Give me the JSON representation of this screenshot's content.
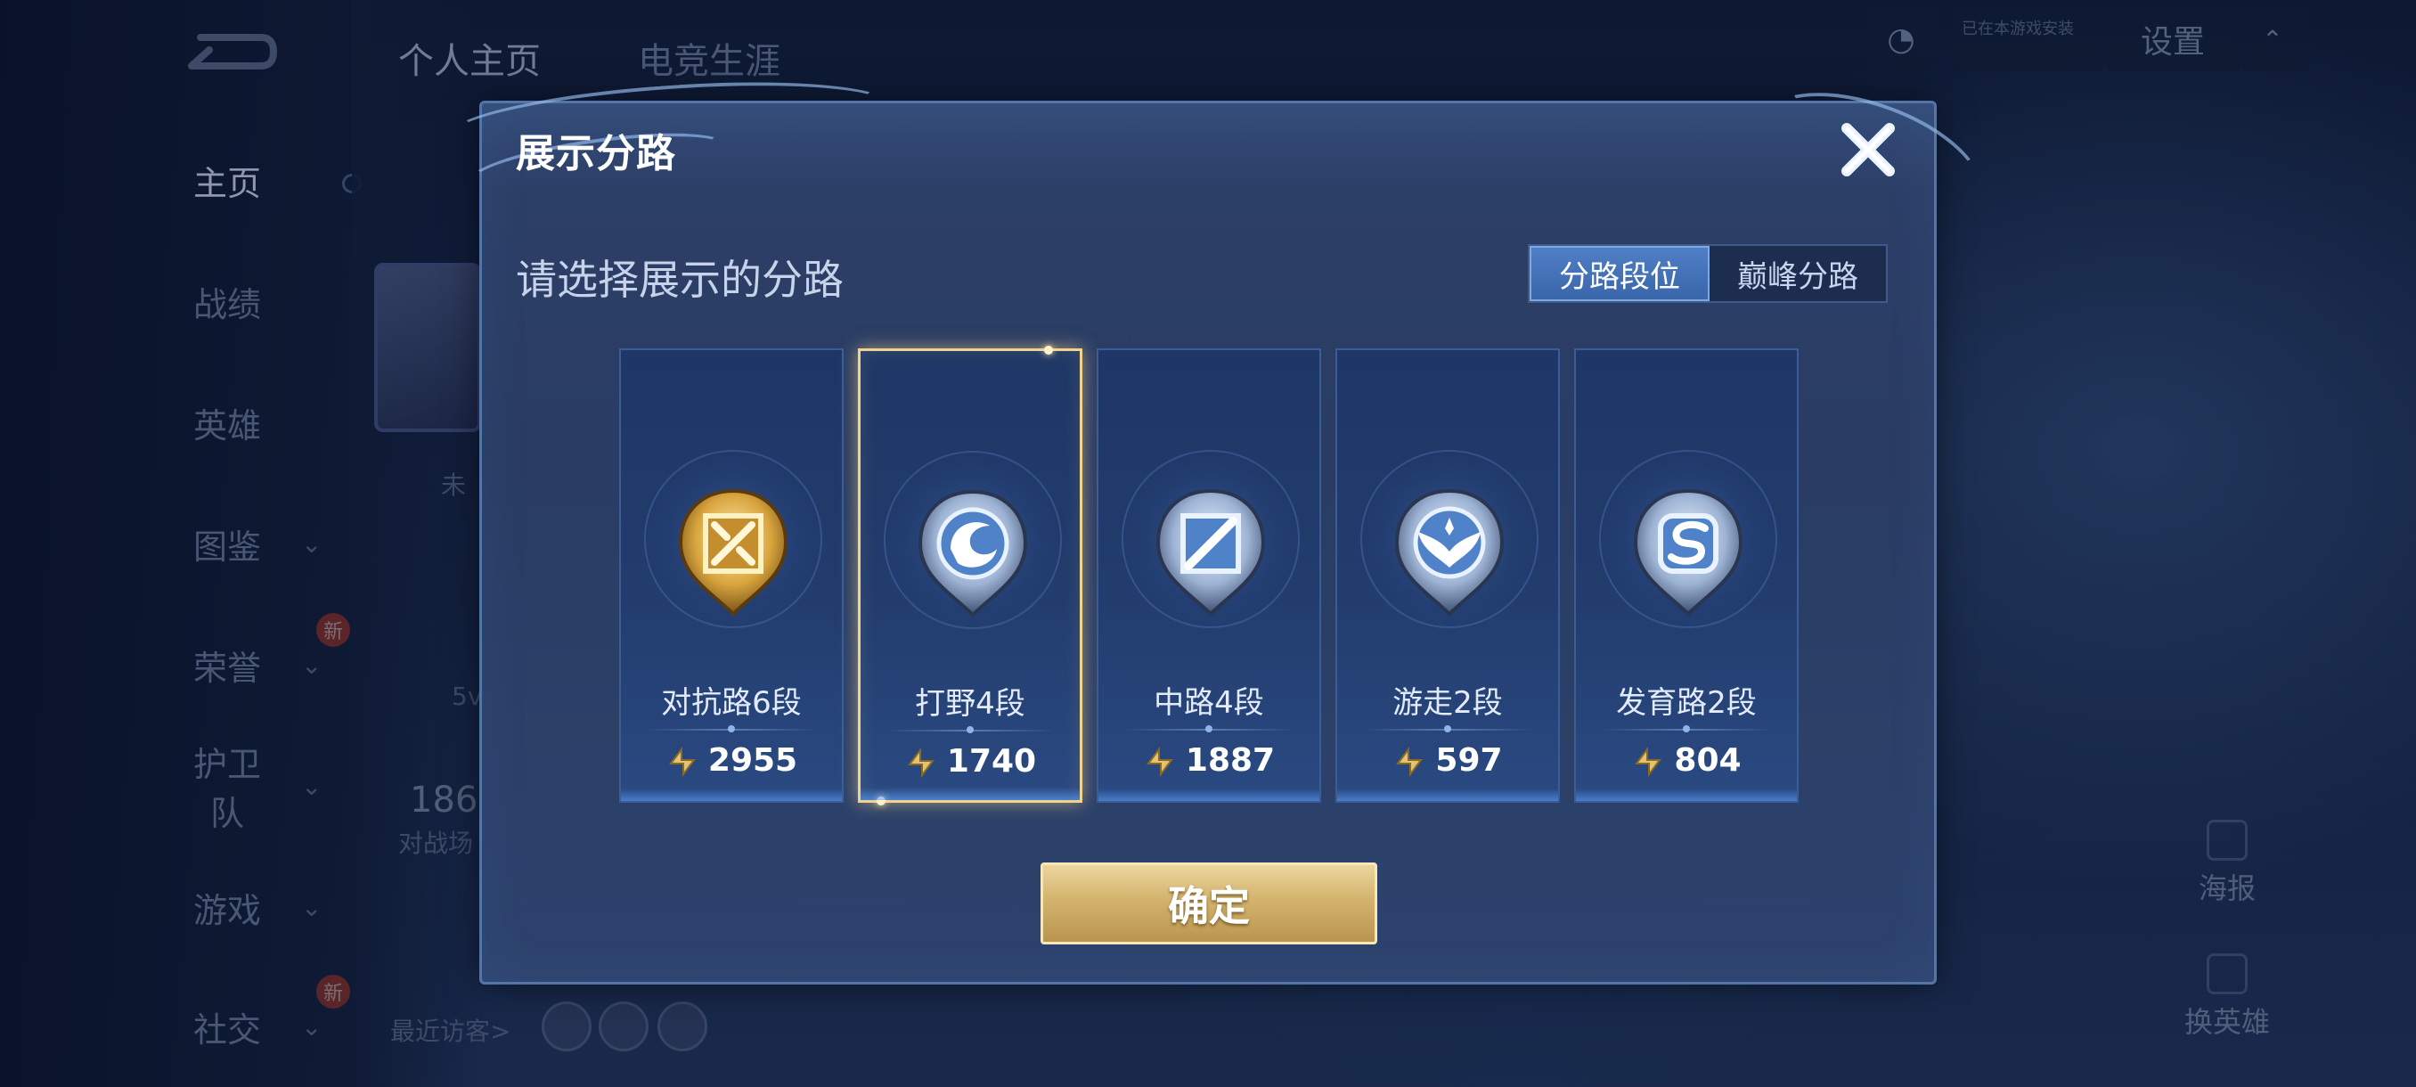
{
  "background": {
    "left_nav": [
      {
        "label": "主页",
        "active": true
      },
      {
        "label": "战绩"
      },
      {
        "label": "英雄"
      },
      {
        "label": "图鉴",
        "has_chevron": true
      },
      {
        "label": "荣誉",
        "has_chevron": true,
        "new_badge": "新"
      },
      {
        "label": "护卫队",
        "has_chevron": true
      },
      {
        "label": "游戏",
        "has_chevron": true
      },
      {
        "label": "社交",
        "has_chevron": true,
        "new_badge": "新"
      }
    ],
    "tabs": [
      "个人主页",
      "电竞生涯"
    ],
    "settings_label": "设置",
    "status_text": "已在本游戏安装",
    "recent_visitors": "最近访客>",
    "partial_texts": {
      "status_partial": "未",
      "mode_partial": "5v",
      "count_partial": "186",
      "count_caption": "对战场"
    },
    "side_buttons": [
      "海报",
      "换英雄"
    ],
    "icons": [
      "back-arrow-icon",
      "qq-icon",
      "chevron-up-icon",
      "poster-icon",
      "swap-hero-icon"
    ]
  },
  "modal": {
    "title": "展示分路",
    "close_icon": "close-x-icon",
    "subtitle": "请选择展示的分路",
    "segment": [
      {
        "label": "分路段位",
        "active": true
      },
      {
        "label": "巅峰分路",
        "active": false
      }
    ],
    "cards": [
      {
        "rank": "对抗路6段",
        "score": "2955",
        "badge": "clash-lane-badge-icon",
        "tier": "gold",
        "selected": false
      },
      {
        "rank": "打野4段",
        "score": "1740",
        "badge": "jungle-dragon-badge-icon",
        "tier": "silver",
        "selected": true
      },
      {
        "rank": "中路4段",
        "score": "1887",
        "badge": "mid-lane-badge-icon",
        "tier": "silver",
        "selected": false
      },
      {
        "rank": "游走2段",
        "score": "597",
        "badge": "roam-wings-badge-icon",
        "tier": "silver",
        "selected": false
      },
      {
        "rank": "发育路2段",
        "score": "804",
        "badge": "farm-lane-badge-icon",
        "tier": "silver",
        "selected": false
      }
    ],
    "confirm_label": "确定"
  },
  "colors": {
    "modal_bg": "#2d4068",
    "selected_border": "#f0d38c",
    "segment_active": "#4f7fc6",
    "confirm_gold": "#d3b36d"
  }
}
